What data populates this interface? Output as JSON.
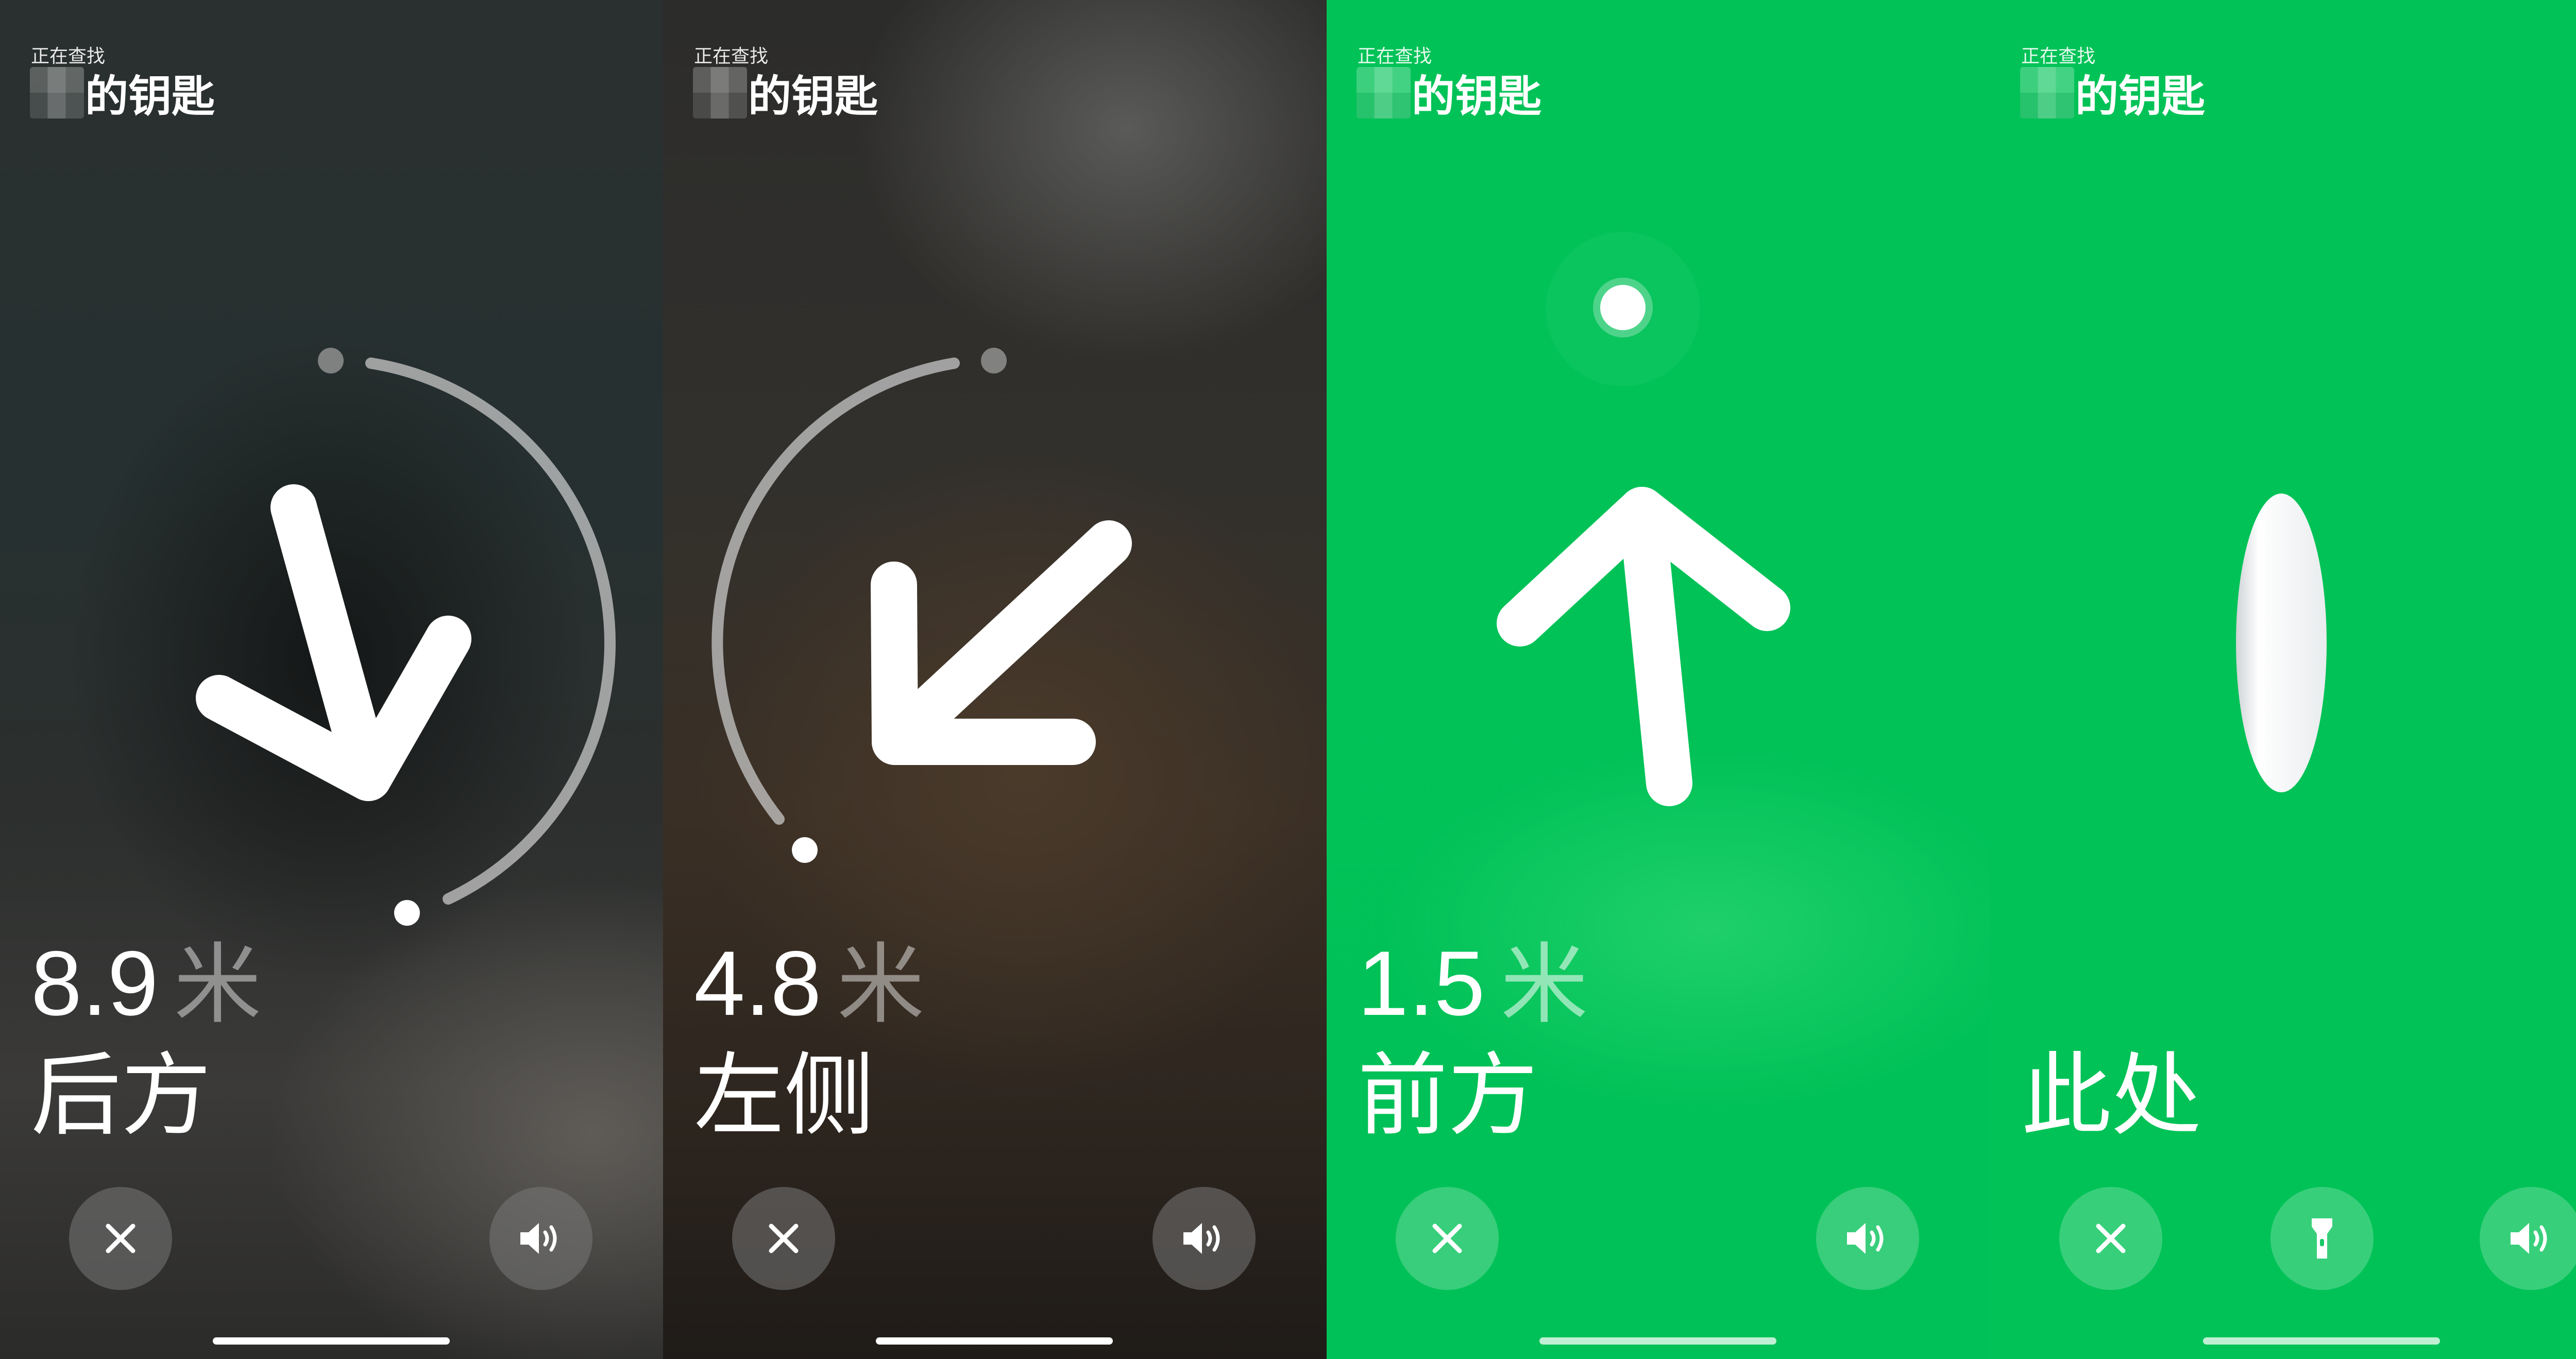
{
  "screens": [
    {
      "header_small": "正在查找",
      "title": "的钥匙",
      "distance_value": "8.9",
      "distance_unit": "米",
      "direction": "后方",
      "arrow_icon": "arrow-down-left-icon"
    },
    {
      "header_small": "正在查找",
      "title": "的钥匙",
      "distance_value": "4.8",
      "distance_unit": "米",
      "direction": "左侧",
      "arrow_icon": "arrow-down-left-icon"
    },
    {
      "header_small": "正在查找",
      "title": "的钥匙",
      "distance_value": "1.5",
      "distance_unit": "米",
      "direction": "前方",
      "arrow_icon": "arrow-up-icon"
    },
    {
      "header_small": "正在查找",
      "title": "的钥匙",
      "direction": "此处",
      "item_icon": "airtag-icon"
    }
  ],
  "controls": {
    "close_icon": "close-icon",
    "sound_icon": "speaker-icon",
    "torch_icon": "flashlight-icon"
  },
  "colors": {
    "found_green": "#00c257",
    "dark_bg": "#2a302f",
    "text": "#ffffff"
  }
}
